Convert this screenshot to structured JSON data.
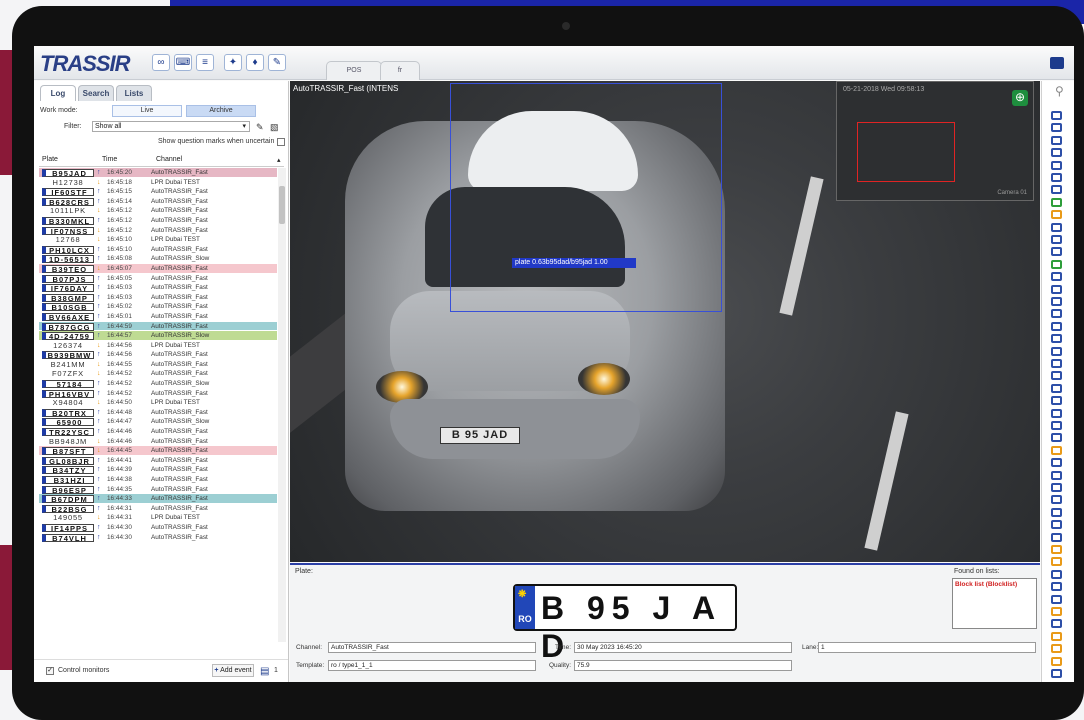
{
  "app": {
    "logo": "TRASSIR",
    "top_tabs": [
      "POS",
      "fr"
    ]
  },
  "left": {
    "tabs": [
      "Log",
      "Search",
      "Lists"
    ],
    "work_mode_label": "Work mode:",
    "mode_live": "Live",
    "mode_archive": "Archive",
    "filter_label": "Filter:",
    "filter_value": "Show all",
    "uncertain_label": "Show question marks when uncertain",
    "columns": {
      "plate": "Plate",
      "time": "Time",
      "channel": "Channel"
    },
    "control_monitors": "Control monitors",
    "add_event": "Add event",
    "count": "1"
  },
  "rows": [
    {
      "plate": "B95JAD",
      "time": "16:45:20",
      "channel": "AutoTRASSIR_Fast",
      "dir": "up",
      "hl": "#e6b7c4",
      "style": "eu"
    },
    {
      "plate": "H12738",
      "time": "16:45:18",
      "channel": "LPR Dubai TEST",
      "dir": "down",
      "hl": "",
      "style": "tx"
    },
    {
      "plate": "IF60STF",
      "time": "16:45:15",
      "channel": "AutoTRASSIR_Fast",
      "dir": "up",
      "hl": "",
      "style": "eu"
    },
    {
      "plate": "B628CRS",
      "time": "16:45:14",
      "channel": "AutoTRASSIR_Fast",
      "dir": "up",
      "hl": "",
      "style": "eu"
    },
    {
      "plate": "1011LPK",
      "time": "16:45:12",
      "channel": "AutoTRASSIR_Fast",
      "dir": "down",
      "hl": "",
      "style": "tx"
    },
    {
      "plate": "B330MKL",
      "time": "16:45:12",
      "channel": "AutoTRASSIR_Fast",
      "dir": "up",
      "hl": "",
      "style": "eu"
    },
    {
      "plate": "IF07NSS",
      "time": "16:45:12",
      "channel": "AutoTRASSIR_Fast",
      "dir": "down",
      "hl": "",
      "style": "eu"
    },
    {
      "plate": "12768",
      "time": "16:45:10",
      "channel": "LPR Dubai TEST",
      "dir": "down",
      "hl": "",
      "style": "tx"
    },
    {
      "plate": "PH10LCX",
      "time": "16:45:10",
      "channel": "AutoTRASSIR_Fast",
      "dir": "up",
      "hl": "",
      "style": "eu"
    },
    {
      "plate": "1D-56513",
      "time": "16:45:08",
      "channel": "AutoTRASSIR_Slow",
      "dir": "up",
      "hl": "",
      "style": "eu"
    },
    {
      "plate": "B39TEO",
      "time": "16:45:07",
      "channel": "AutoTRASSIR_Fast",
      "dir": "down",
      "hl": "#f5c7cd",
      "style": "eu"
    },
    {
      "plate": "B07PJS",
      "time": "16:45:05",
      "channel": "AutoTRASSIR_Fast",
      "dir": "up",
      "hl": "",
      "style": "eu"
    },
    {
      "plate": "IF76DAY",
      "time": "16:45:03",
      "channel": "AutoTRASSIR_Fast",
      "dir": "up",
      "hl": "",
      "style": "eu"
    },
    {
      "plate": "B38GMP",
      "time": "16:45:03",
      "channel": "AutoTRASSIR_Fast",
      "dir": "up",
      "hl": "",
      "style": "eu"
    },
    {
      "plate": "B10SGB",
      "time": "16:45:02",
      "channel": "AutoTRASSIR_Fast",
      "dir": "up",
      "hl": "",
      "style": "eu"
    },
    {
      "plate": "BV66AXE",
      "time": "16:45:01",
      "channel": "AutoTRASSIR_Fast",
      "dir": "up",
      "hl": "",
      "style": "eu"
    },
    {
      "plate": "B787GCG",
      "time": "16:44:59",
      "channel": "AutoTRASSIR_Fast",
      "dir": "up",
      "hl": "#9ccfd3",
      "style": "eu"
    },
    {
      "plate": "4D-24759",
      "time": "16:44:57",
      "channel": "AutoTRASSIR_Slow",
      "dir": "up",
      "hl": "#bfdb93",
      "style": "eu"
    },
    {
      "plate": "126374",
      "time": "16:44:56",
      "channel": "LPR Dubai TEST",
      "dir": "down",
      "hl": "",
      "style": "tx"
    },
    {
      "plate": "B939BMW",
      "time": "16:44:56",
      "channel": "AutoTRASSIR_Fast",
      "dir": "up",
      "hl": "",
      "style": "eu"
    },
    {
      "plate": "B241MM",
      "time": "16:44:55",
      "channel": "AutoTRASSIR_Fast",
      "dir": "down",
      "hl": "",
      "style": "tx"
    },
    {
      "plate": "F07ZFX",
      "time": "16:44:52",
      "channel": "AutoTRASSIR_Fast",
      "dir": "down",
      "hl": "",
      "style": "tx"
    },
    {
      "plate": "57184",
      "time": "16:44:52",
      "channel": "AutoTRASSIR_Slow",
      "dir": "up",
      "hl": "",
      "style": "eu"
    },
    {
      "plate": "PH16VBV",
      "time": "16:44:52",
      "channel": "AutoTRASSIR_Fast",
      "dir": "up",
      "hl": "",
      "style": "eu"
    },
    {
      "plate": "X94804",
      "time": "16:44:50",
      "channel": "LPR Dubai TEST",
      "dir": "down",
      "hl": "",
      "style": "tx"
    },
    {
      "plate": "B20TRX",
      "time": "16:44:48",
      "channel": "AutoTRASSIR_Fast",
      "dir": "up",
      "hl": "",
      "style": "eu"
    },
    {
      "plate": "65900",
      "time": "16:44:47",
      "channel": "AutoTRASSIR_Slow",
      "dir": "up",
      "hl": "",
      "style": "eu"
    },
    {
      "plate": "TR22YSC",
      "time": "16:44:46",
      "channel": "AutoTRASSIR_Fast",
      "dir": "up",
      "hl": "",
      "style": "eu"
    },
    {
      "plate": "BB948JM",
      "time": "16:44:46",
      "channel": "AutoTRASSIR_Fast",
      "dir": "down",
      "hl": "",
      "style": "tx"
    },
    {
      "plate": "B87SFT",
      "time": "16:44:45",
      "channel": "AutoTRASSIR_Fast",
      "dir": "down",
      "hl": "#f5c7cd",
      "style": "eu"
    },
    {
      "plate": "GL08BJR",
      "time": "16:44:41",
      "channel": "AutoTRASSIR_Fast",
      "dir": "up",
      "hl": "",
      "style": "eu"
    },
    {
      "plate": "B34TZY",
      "time": "16:44:39",
      "channel": "AutoTRASSIR_Fast",
      "dir": "up",
      "hl": "",
      "style": "eu"
    },
    {
      "plate": "B31HZI",
      "time": "16:44:38",
      "channel": "AutoTRASSIR_Fast",
      "dir": "up",
      "hl": "",
      "style": "eu"
    },
    {
      "plate": "B96ESP",
      "time": "16:44:35",
      "channel": "AutoTRASSIR_Fast",
      "dir": "up",
      "hl": "",
      "style": "eu"
    },
    {
      "plate": "B67DPM",
      "time": "16:44:33",
      "channel": "AutoTRASSIR_Fast",
      "dir": "up",
      "hl": "#9ccfd3",
      "style": "eu"
    },
    {
      "plate": "B22BSG",
      "time": "16:44:31",
      "channel": "AutoTRASSIR_Fast",
      "dir": "up",
      "hl": "",
      "style": "eu"
    },
    {
      "plate": "149055",
      "time": "16:44:31",
      "channel": "LPR Dubai TEST",
      "dir": "down",
      "hl": "",
      "style": "tx"
    },
    {
      "plate": "IF14PPS",
      "time": "16:44:30",
      "channel": "AutoTRASSIR_Fast",
      "dir": "up",
      "hl": "",
      "style": "eu"
    },
    {
      "plate": "B74VLH",
      "time": "16:44:30",
      "channel": "AutoTRASSIR_Fast",
      "dir": "up",
      "hl": "",
      "style": "eu"
    }
  ],
  "video": {
    "title": "AutoTRASSIR_Fast (INTENS",
    "detection_label": "plate 0.63b95dad/b95jad 1.00",
    "car_plate": "B 95 JAD",
    "inset_timestamp": "05-21-2018 Wed 09:58:13",
    "inset_camera": "Camera 01"
  },
  "info": {
    "plate_label": "Plate:",
    "plate_country": "RO",
    "plate_text": "B 95 J A D",
    "found_label": "Found on lists:",
    "found_value": "Block list (Blocklist)",
    "channel_label": "Channel:",
    "channel_value": "AutoTRASSIR_Fast",
    "template_label": "Template:",
    "template_value": "ro / type1_1_1",
    "time_label": "Time:",
    "time_value": "30 May 2023 16:45:20",
    "quality_label": "Quality:",
    "quality_value": "75.9",
    "lane_label": "Lane:",
    "lane_value": "1"
  },
  "right_icons": [
    "b",
    "b",
    "b",
    "b",
    "b",
    "b",
    "b",
    "g",
    "o",
    "b",
    "b",
    "b",
    "g",
    "b",
    "b",
    "b",
    "b",
    "b",
    "b",
    "b",
    "b",
    "b",
    "b",
    "b",
    "b",
    "b",
    "b",
    "o",
    "b",
    "b",
    "b",
    "b",
    "b",
    "b",
    "b",
    "o",
    "o",
    "b",
    "b",
    "b",
    "o",
    "b",
    "o",
    "o",
    "o",
    "b"
  ],
  "colors": {
    "accent": "#2b3fa6",
    "brand_red": "#c8102e",
    "alert": "#d02020"
  }
}
